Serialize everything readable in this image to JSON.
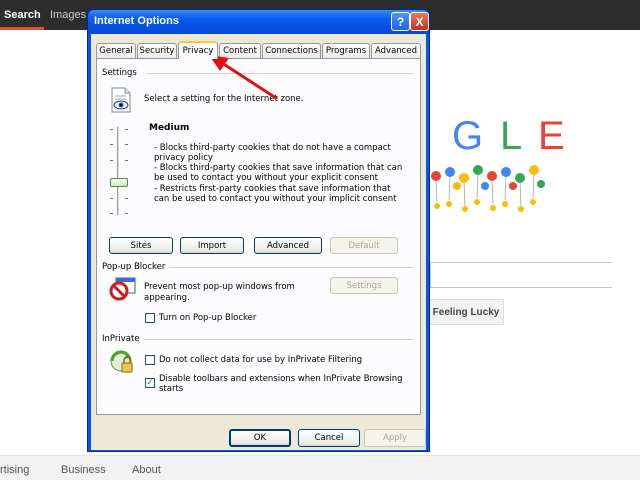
{
  "background": {
    "nav": {
      "search": "Search",
      "images": "Images"
    },
    "logo_letters": [
      "G",
      "L",
      "E"
    ],
    "lucky_button": "Feeling Lucky",
    "footer": [
      "rtising",
      "Business",
      "About"
    ]
  },
  "dialog": {
    "title": "Internet Options",
    "help_glyph": "?",
    "close_glyph": "X",
    "tabs": [
      "General",
      "Security",
      "Privacy",
      "Content",
      "Connections",
      "Programs",
      "Advanced"
    ],
    "selected_tab": "Privacy",
    "settings": {
      "label": "Settings",
      "instruction": "Select a setting for the Internet zone.",
      "level": "Medium",
      "description": [
        "- Blocks third-party cookies that do not have a compact",
        "privacy policy",
        "- Blocks third-party cookies that save information that can",
        "be used to contact you without your explicit consent",
        "- Restricts first-party cookies that save information that",
        "can be used to contact you without your implicit consent"
      ],
      "buttons": {
        "sites": "Sites",
        "import": "Import",
        "advanced": "Advanced",
        "default": "Default"
      }
    },
    "popup": {
      "label": "Pop-up Blocker",
      "description_1": "Prevent most pop-up windows from",
      "description_2": "appearing.",
      "settings_button": "Settings",
      "checkbox_label": "Turn on Pop-up Blocker",
      "checked": false
    },
    "inprivate": {
      "label": "InPrivate",
      "checkbox1_label": "Do not collect data for use by InPrivate Filtering",
      "checkbox1_checked": false,
      "checkbox2_label_1": "Disable toolbars and extensions when InPrivate Browsing",
      "checkbox2_label_2": "starts",
      "checkbox2_checked": true,
      "check_glyph": "✓"
    },
    "footer_buttons": {
      "ok": "OK",
      "cancel": "Cancel",
      "apply": "Apply"
    }
  },
  "colors": {
    "titlebar": "#0a5df0",
    "dialog_face": "#ece9d8",
    "annotation_arrow": "#e01010",
    "logo_g": "#4285f4",
    "logo_l": "#34a853",
    "logo_e": "#ea4335"
  }
}
